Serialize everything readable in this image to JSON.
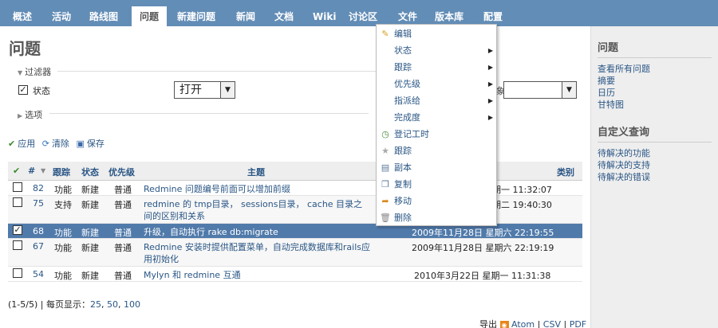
{
  "menu": {
    "tabs": [
      {
        "label": "概述"
      },
      {
        "label": "活动"
      },
      {
        "label": "路线图"
      },
      {
        "label": "问题",
        "selected": true
      },
      {
        "label": "新建问题"
      },
      {
        "label": "新闻"
      },
      {
        "label": "文档"
      },
      {
        "label": "Wiki"
      },
      {
        "label": "讨论区"
      },
      {
        "label": "文件"
      },
      {
        "label": "版本库"
      },
      {
        "label": "配置"
      }
    ]
  },
  "page": {
    "title": "问题",
    "filters_legend": "过滤器",
    "options_legend": "选项",
    "filter_status_label": "状态",
    "filter_status_value": "打开",
    "filter_partial_label": "象"
  },
  "actions": {
    "apply": "应用",
    "clear": "清除",
    "save": "保存"
  },
  "table": {
    "headers": {
      "check": "✔",
      "id": "#",
      "tracker": "跟踪",
      "status": "状态",
      "priority": "优先级",
      "subject": "主题",
      "category": "类别"
    },
    "rows": [
      {
        "id": "82",
        "tracker": "功能",
        "status": "新建",
        "priority": "普通",
        "subject": "Redmine 问题编号前面可以增加前缀",
        "updated": "期一 11:32:07",
        "checked": false
      },
      {
        "id": "75",
        "tracker": "支持",
        "status": "新建",
        "priority": "普通",
        "subject": "redmine 的 tmp目录， sessions目录， cache 目录之间的区别和关系",
        "updated": "期二 19:40:30",
        "checked": false
      },
      {
        "id": "68",
        "tracker": "功能",
        "status": "新建",
        "priority": "普通",
        "subject": "升级，自动执行 rake db:migrate",
        "updated": "2009年11月28日 星期六 22:19:55",
        "checked": true
      },
      {
        "id": "67",
        "tracker": "功能",
        "status": "新建",
        "priority": "普通",
        "subject": "Redmine 安装时提供配置菜单，自动完成数据库和rails应用初始化",
        "updated": "2009年11月28日 星期六 22:19:19",
        "checked": false
      },
      {
        "id": "54",
        "tracker": "功能",
        "status": "新建",
        "priority": "普通",
        "subject": "Mylyn 和 redmine 互通",
        "updated": "2010年3月22日 星期一 11:31:38",
        "checked": false
      }
    ]
  },
  "pagination": {
    "text": "(1-5/5) | 每页显示：",
    "p25": "25",
    "p50": "50",
    "p100": "100"
  },
  "export": {
    "label": "导出",
    "atom": "Atom",
    "csv": "CSV",
    "pdf": "PDF"
  },
  "context_menu": {
    "items": [
      {
        "label": "编辑",
        "icon": "pencil-icon",
        "submenu": false
      },
      {
        "label": "状态",
        "icon": "",
        "submenu": true
      },
      {
        "label": "跟踪",
        "icon": "",
        "submenu": true
      },
      {
        "label": "优先级",
        "icon": "",
        "submenu": true
      },
      {
        "label": "指派给",
        "icon": "",
        "submenu": true
      },
      {
        "label": "完成度",
        "icon": "",
        "submenu": true
      },
      {
        "label": "登记工时",
        "icon": "clock-icon",
        "submenu": false
      },
      {
        "label": "跟踪",
        "icon": "star-icon",
        "submenu": false
      },
      {
        "label": "副本",
        "icon": "duplicate-icon",
        "submenu": false
      },
      {
        "label": "复制",
        "icon": "copy-icon",
        "submenu": false
      },
      {
        "label": "移动",
        "icon": "move-icon",
        "submenu": false
      },
      {
        "label": "删除",
        "icon": "trash-icon",
        "submenu": false
      }
    ]
  },
  "sidebar": {
    "issues_title": "问题",
    "links": [
      "查看所有问题",
      "摘要",
      "日历",
      "甘特图"
    ],
    "custom_title": "自定义查询",
    "queries": [
      "待解决的功能",
      "待解决的支持",
      "待解决的错误"
    ]
  },
  "colors": {
    "menu_bg": "#628db6",
    "selected_row": "#507aaa",
    "link": "#2a5685"
  }
}
